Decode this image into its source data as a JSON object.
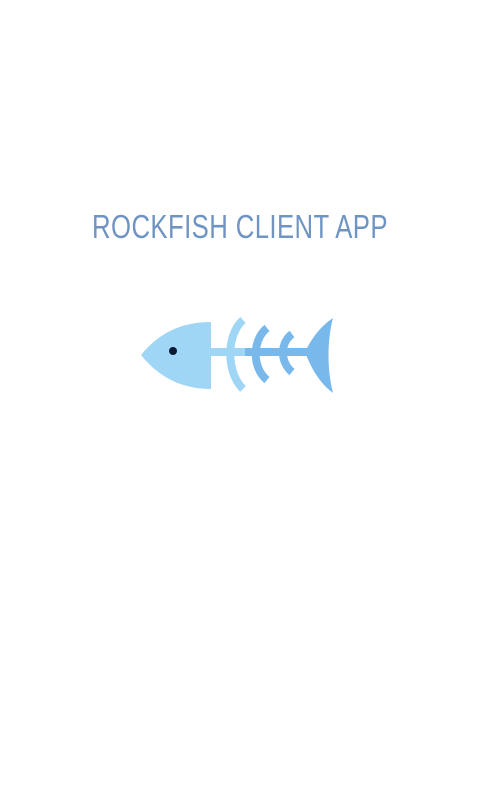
{
  "app_title": "ROCKFISH CLIENT APP",
  "logo": {
    "icon": "fish-skeleton-icon",
    "colors": {
      "head": "#a0d6f5",
      "body": "#78b8ea",
      "eye": "#0b1a33"
    }
  }
}
